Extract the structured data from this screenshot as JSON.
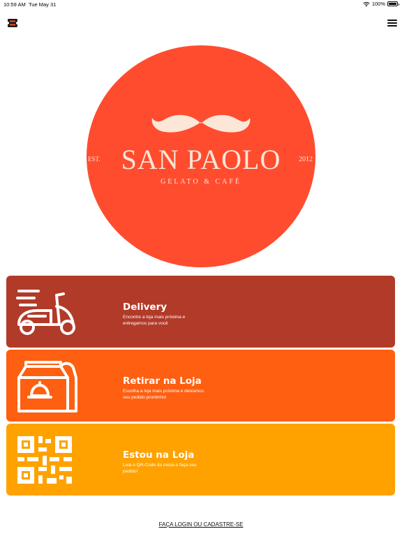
{
  "status_bar": {
    "time": "10:59 AM",
    "date": "Tue May 31",
    "battery": "100%",
    "battery_level": 1.0,
    "wifi_icon": "wifi-icon"
  },
  "header": {
    "brand_icon": "ticket-logo-icon",
    "menu_icon": "hamburger-menu-icon"
  },
  "logo": {
    "name": "SAN PAOLO",
    "est": "EST.",
    "year": "2012",
    "tagline": "GELATO & CAFÉ",
    "icon": "mustache-icon"
  },
  "options": [
    {
      "title": "Delivery",
      "description": "Encontre a loja mais próxima e entregamos para você",
      "icon": "scooter-icon",
      "color": "#b23a28"
    },
    {
      "title": "Retirar na Loja",
      "description": "Escolha a loja mais próxima e deixamos seu pedido prontinho!",
      "icon": "takeaway-bag-icon",
      "color": "#ff5f10"
    },
    {
      "title": "Estou na Loja",
      "description": "Leia o QR-Code da mesa e faça seu pedido!",
      "icon": "qr-code-icon",
      "color": "#ffa200"
    }
  ],
  "footer": {
    "login_label": "FAÇA LOGIN OU CADASTRE-SE"
  },
  "colors": {
    "brand_red": "#ff4c2f",
    "logo_text": "#fbe6d8"
  }
}
